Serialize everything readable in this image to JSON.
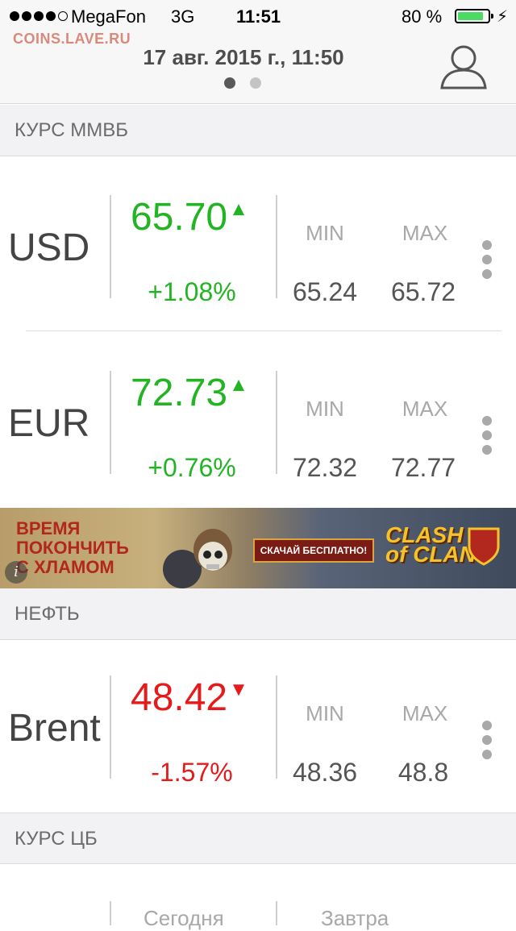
{
  "status_bar": {
    "carrier": "MegaFon",
    "network": "3G",
    "time": "11:51",
    "battery_percent": "80 %",
    "signal_bars_filled": 4,
    "signal_bars_total": 5
  },
  "watermark": "COINS.LAVE.RU",
  "header": {
    "date": "17 авг. 2015 г., 11:50",
    "page_index": 0,
    "page_count": 2,
    "icons": [
      "user-icon"
    ]
  },
  "sections": {
    "mmvb": "КУРС ММВБ",
    "oil": "НЕФТЬ",
    "cb": "КУРС ЦБ"
  },
  "columns": {
    "min": "MIN",
    "max": "MAX"
  },
  "rates": [
    {
      "code": "USD",
      "price": "65.70",
      "direction": "up",
      "arrow": "▲",
      "change": "+1.08%",
      "min": "65.24",
      "max": "65.72"
    },
    {
      "code": "EUR",
      "price": "72.73",
      "direction": "up",
      "arrow": "▲",
      "change": "+0.76%",
      "min": "72.32",
      "max": "72.77"
    }
  ],
  "oil": [
    {
      "code": "Brent",
      "price": "48.42",
      "direction": "down",
      "arrow": "▼",
      "change": "-1.57%",
      "min": "48.36",
      "max": "48.8"
    }
  ],
  "cb_columns": {
    "today": "Сегодня",
    "tomorrow": "Завтра"
  },
  "ad": {
    "headline_1": "ВРЕМЯ",
    "headline_2": "ПОКОНЧИТЬ",
    "headline_3": "С ХЛАМОМ",
    "cta": "СКАЧАЙ БЕСПЛАТНО!",
    "brand_1": "CLASH",
    "brand_2": "of CLANS",
    "info_icon": "i"
  },
  "colors": {
    "up": "#22b422",
    "down": "#e51a1a",
    "battery": "#4cd964"
  }
}
